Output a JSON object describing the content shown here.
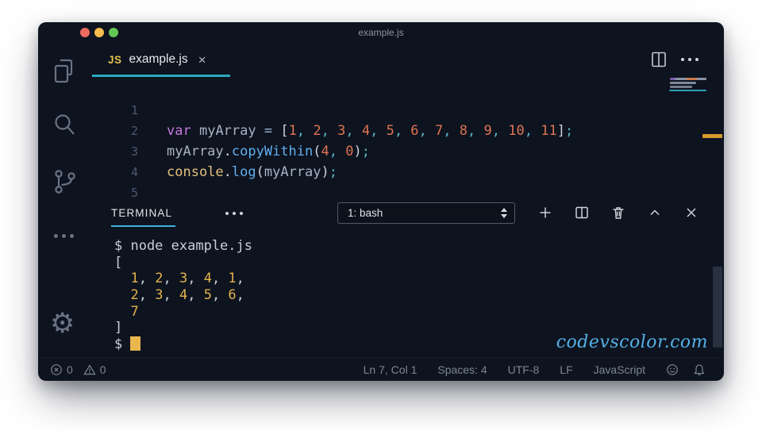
{
  "window": {
    "title": "example.js",
    "traffic_lights": [
      "#ee6a5f",
      "#f5bd4f",
      "#62c554"
    ]
  },
  "tab": {
    "icon_label": "JS",
    "label": "example.js",
    "close_glyph": "×"
  },
  "activity_bar": {
    "icons": [
      "files-explorer",
      "search",
      "source-control",
      "more",
      "settings-gear"
    ]
  },
  "editor": {
    "line_numbers": [
      "1",
      "2",
      "3",
      "4",
      "5"
    ],
    "lines": [
      {
        "tokens": [
          {
            "t": "var",
            "c": "kw"
          },
          {
            "t": " ",
            "c": "fg"
          },
          {
            "t": "myArray",
            "c": "fg"
          },
          {
            "t": " ",
            "c": "fg"
          },
          {
            "t": "=",
            "c": "op"
          },
          {
            "t": " ",
            "c": "fg"
          },
          {
            "t": "[",
            "c": "br"
          },
          {
            "t": "1",
            "c": "num"
          },
          {
            "t": ", ",
            "c": "punc"
          },
          {
            "t": "2",
            "c": "num"
          },
          {
            "t": ", ",
            "c": "punc"
          },
          {
            "t": "3",
            "c": "num"
          },
          {
            "t": ", ",
            "c": "punc"
          },
          {
            "t": "4",
            "c": "num"
          },
          {
            "t": ", ",
            "c": "punc"
          },
          {
            "t": "5",
            "c": "num"
          },
          {
            "t": ", ",
            "c": "punc"
          },
          {
            "t": "6",
            "c": "num"
          },
          {
            "t": ", ",
            "c": "punc"
          },
          {
            "t": "7",
            "c": "num"
          },
          {
            "t": ", ",
            "c": "punc"
          },
          {
            "t": "8",
            "c": "num"
          },
          {
            "t": ", ",
            "c": "punc"
          },
          {
            "t": "9",
            "c": "num"
          },
          {
            "t": ", ",
            "c": "punc"
          },
          {
            "t": "10",
            "c": "num"
          },
          {
            "t": ", ",
            "c": "punc"
          },
          {
            "t": "11",
            "c": "num"
          },
          {
            "t": "]",
            "c": "br"
          },
          {
            "t": ";",
            "c": "punc"
          }
        ]
      },
      {
        "tokens": [
          {
            "t": "myArray",
            "c": "fg"
          },
          {
            "t": ".",
            "c": "br"
          },
          {
            "t": "copyWithin",
            "c": "fn"
          },
          {
            "t": "(",
            "c": "br"
          },
          {
            "t": "4",
            "c": "num"
          },
          {
            "t": ", ",
            "c": "punc"
          },
          {
            "t": "0",
            "c": "num"
          },
          {
            "t": ")",
            "c": "br"
          },
          {
            "t": ";",
            "c": "punc"
          }
        ]
      },
      {
        "tokens": [
          {
            "t": "console",
            "c": "obj"
          },
          {
            "t": ".",
            "c": "br"
          },
          {
            "t": "log",
            "c": "fn"
          },
          {
            "t": "(",
            "c": "br"
          },
          {
            "t": "myArray",
            "c": "fg"
          },
          {
            "t": ")",
            "c": "br"
          },
          {
            "t": ";",
            "c": "punc"
          }
        ]
      },
      {
        "tokens": []
      },
      {
        "tokens": []
      }
    ]
  },
  "panel": {
    "tab_label": "TERMINAL",
    "dropdown_value": "1: bash",
    "icons": [
      "plus",
      "split-terminal",
      "trash",
      "chevron-up",
      "close"
    ]
  },
  "terminal": {
    "lines": [
      {
        "tokens": [
          {
            "t": "$ node example.js",
            "c": "tfg"
          }
        ]
      },
      {
        "tokens": [
          {
            "t": "[",
            "c": "tfg"
          }
        ]
      },
      {
        "tokens": [
          {
            "t": "  ",
            "c": "tfg"
          },
          {
            "t": "1",
            "c": "tnum"
          },
          {
            "t": ", ",
            "c": "tfg"
          },
          {
            "t": "2",
            "c": "tnum"
          },
          {
            "t": ", ",
            "c": "tfg"
          },
          {
            "t": "3",
            "c": "tnum"
          },
          {
            "t": ", ",
            "c": "tfg"
          },
          {
            "t": "4",
            "c": "tnum"
          },
          {
            "t": ", ",
            "c": "tfg"
          },
          {
            "t": "1",
            "c": "tnum"
          },
          {
            "t": ",",
            "c": "tfg"
          }
        ]
      },
      {
        "tokens": [
          {
            "t": "  ",
            "c": "tfg"
          },
          {
            "t": "2",
            "c": "tnum"
          },
          {
            "t": ", ",
            "c": "tfg"
          },
          {
            "t": "3",
            "c": "tnum"
          },
          {
            "t": ", ",
            "c": "tfg"
          },
          {
            "t": "4",
            "c": "tnum"
          },
          {
            "t": ", ",
            "c": "tfg"
          },
          {
            "t": "5",
            "c": "tnum"
          },
          {
            "t": ", ",
            "c": "tfg"
          },
          {
            "t": "6",
            "c": "tnum"
          },
          {
            "t": ",",
            "c": "tfg"
          }
        ]
      },
      {
        "tokens": [
          {
            "t": "  ",
            "c": "tfg"
          },
          {
            "t": "7",
            "c": "tnum"
          }
        ]
      },
      {
        "tokens": [
          {
            "t": "]",
            "c": "tfg"
          }
        ]
      },
      {
        "tokens": [
          {
            "t": "$ ",
            "c": "tfg"
          },
          {
            "t": "",
            "c": "cursor"
          }
        ]
      }
    ]
  },
  "watermark": "codevscolor.com",
  "status_bar": {
    "errors": "0",
    "warnings": "0",
    "right_items": [
      "Ln 7, Col 1",
      "Spaces: 4",
      "UTF-8",
      "LF",
      "JavaScript"
    ],
    "right_icons": [
      "smiley",
      "bell"
    ]
  },
  "colors": {
    "window_bg": "#0d131f",
    "tab_underline": "#2aa9bd",
    "terminal_underline": "#41b2dd",
    "terminal_cursor": "#eab64e",
    "overview_mark": "#d9992e",
    "watermark": "#55b1e6",
    "keyword": "#c678dd",
    "number": "#de7452",
    "function": "#61afef",
    "punctuation": "#56b6c2",
    "terminal_number": "#e4b24b"
  }
}
